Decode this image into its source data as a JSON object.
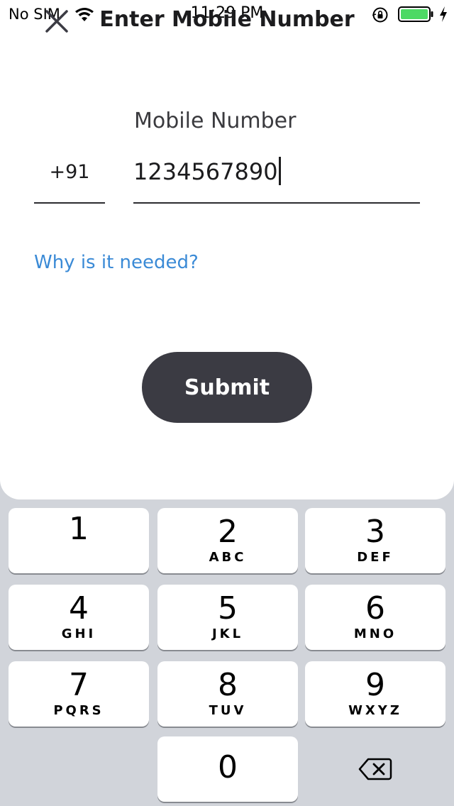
{
  "status_bar": {
    "carrier": "No SIM",
    "time": "11:29 PM"
  },
  "nav": {
    "title": "Enter Mobile Number",
    "close_icon": "close-icon"
  },
  "form": {
    "mobile_label": "Mobile Number",
    "country_code": "+91",
    "mobile_value": "1234567890",
    "why_link": "Why is it needed?",
    "submit_label": "Submit"
  },
  "keypad": {
    "keys": [
      {
        "digit": "1",
        "letters": ""
      },
      {
        "digit": "2",
        "letters": "ABC"
      },
      {
        "digit": "3",
        "letters": "DEF"
      },
      {
        "digit": "4",
        "letters": "GHI"
      },
      {
        "digit": "5",
        "letters": "JKL"
      },
      {
        "digit": "6",
        "letters": "MNO"
      },
      {
        "digit": "7",
        "letters": "PQRS"
      },
      {
        "digit": "8",
        "letters": "TUV"
      },
      {
        "digit": "9",
        "letters": "WXYZ"
      },
      {
        "digit": "0",
        "letters": ""
      }
    ],
    "delete_icon": "backspace-icon"
  },
  "colors": {
    "link": "#3a8ad6",
    "button": "#3b3b43",
    "keyboard_bg": "#d1d4da",
    "battery": "#4cd964"
  }
}
